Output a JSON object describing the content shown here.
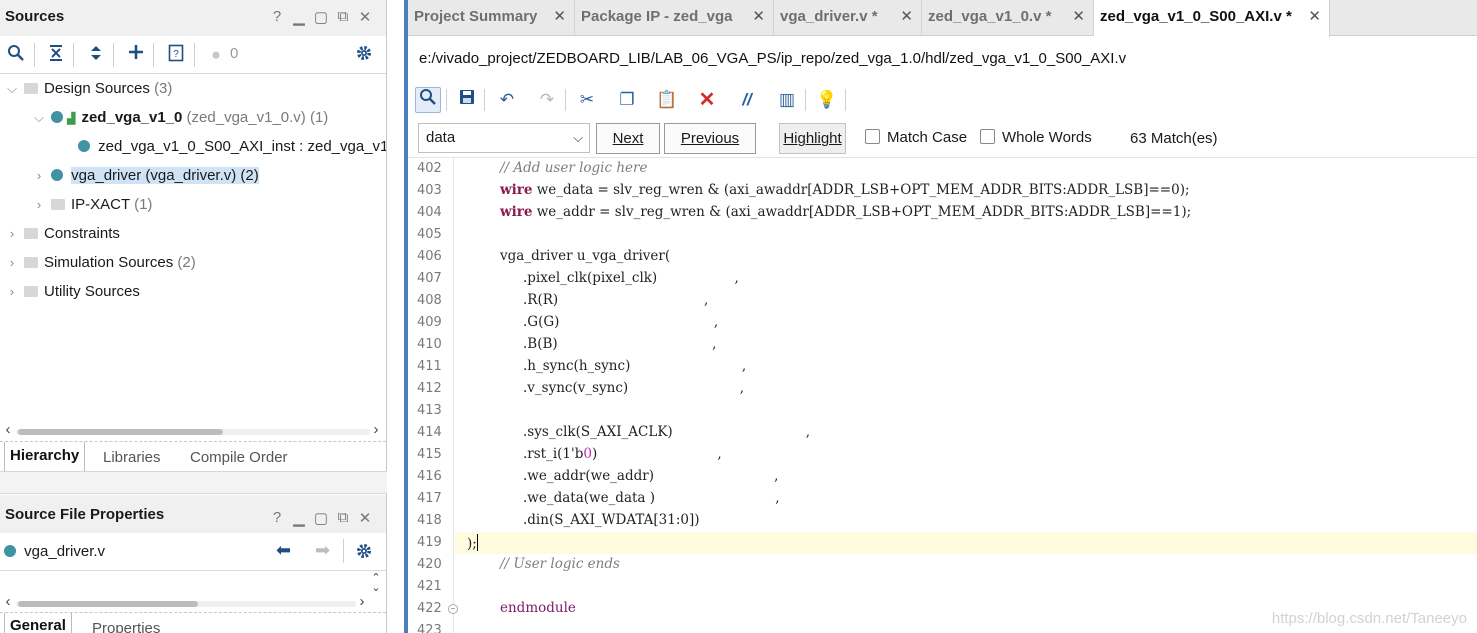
{
  "sources_panel": {
    "title": "Sources",
    "controls": [
      "?",
      "▁",
      "▢",
      "⧉",
      "✕"
    ],
    "toolbar": {
      "count": "0"
    },
    "tree": [
      {
        "label": "Design Sources",
        "suffix": "(3)"
      },
      {
        "label": "zed_vga_v1_0",
        "suffix": "(zed_vga_v1_0.v) (1)"
      },
      {
        "label": "zed_vga_v1_0_S00_AXI_inst : zed_vga_v1_"
      },
      {
        "label": "vga_driver (vga_driver.v) (2)"
      },
      {
        "label": "IP-XACT",
        "suffix": "(1)"
      },
      {
        "label": "Constraints"
      },
      {
        "label": "Simulation Sources",
        "suffix": "(2)"
      },
      {
        "label": "Utility Sources"
      }
    ],
    "tabs": [
      "Hierarchy",
      "Libraries",
      "Compile Order"
    ]
  },
  "properties_panel": {
    "title": "Source File Properties",
    "controls": [
      "?",
      "▁",
      "▢",
      "⧉",
      "✕"
    ],
    "file": "vga_driver.v",
    "tabs": [
      "General",
      "Properties"
    ]
  },
  "editor_tabs": [
    {
      "label": "Project Summary"
    },
    {
      "label": "Package IP - zed_vga"
    },
    {
      "label": "vga_driver.v *"
    },
    {
      "label": "zed_vga_v1_0.v *"
    },
    {
      "label": "zed_vga_v1_0_S00_AXI.v *"
    }
  ],
  "file_path": "e:/vivado_project/ZEDBOARD_LIB/LAB_06_VGA_PS/ip_repo/zed_vga_1.0/hdl/zed_vga_v1_0_S00_AXI.v",
  "find": {
    "query": "data",
    "next": "Next",
    "previous": "Previous",
    "highlight": "Highlight",
    "match_case": "Match Case",
    "whole_words": "Whole Words",
    "matches": "63 Match(es)"
  },
  "code": {
    "line_numbers": [
      "402",
      "403",
      "404",
      "405",
      "406",
      "407",
      "408",
      "409",
      "410",
      "411",
      "412",
      "413",
      "414",
      "415",
      "416",
      "417",
      "418",
      "419",
      "420",
      "421",
      "422",
      "423"
    ],
    "l402": "// Add user logic here",
    "l403_kw": "wire",
    "l403_rest": " we_data = slv_reg_wren & (axi_awaddr[ADDR_LSB+OPT_MEM_ADDR_BITS:ADDR_LSB]==0);",
    "l404_kw": "wire",
    "l404_rest": " we_addr = slv_reg_wren & (axi_awaddr[ADDR_LSB+OPT_MEM_ADDR_BITS:ADDR_LSB]==1);",
    "l406": "vga_driver u_vga_driver(",
    "l407": ".pixel_clk(pixel_clk)                  ,",
    "l408": ".R(R)                                  ,",
    "l409": ".G(G)                                    ,",
    "l410": ".B(B)                                    ,",
    "l411": ".h_sync(h_sync)                          ,",
    "l412": ".v_sync(v_sync)                          ,",
    "l414": ".sys_clk(S_AXI_ACLK)                               ,",
    "l415_a": ".rst_i(1'b",
    "l415_num": "0",
    "l415_b": ")                            ,",
    "l416": ".we_addr(we_addr)                            ,",
    "l417": ".we_data(we_data )                            ,",
    "l418": ".din(S_AXI_WDATA[31:0])",
    "l419": ");",
    "l420": "// User logic ends",
    "l422": "endmodule"
  },
  "watermark": "https://blog.csdn.net/Taneeyo"
}
